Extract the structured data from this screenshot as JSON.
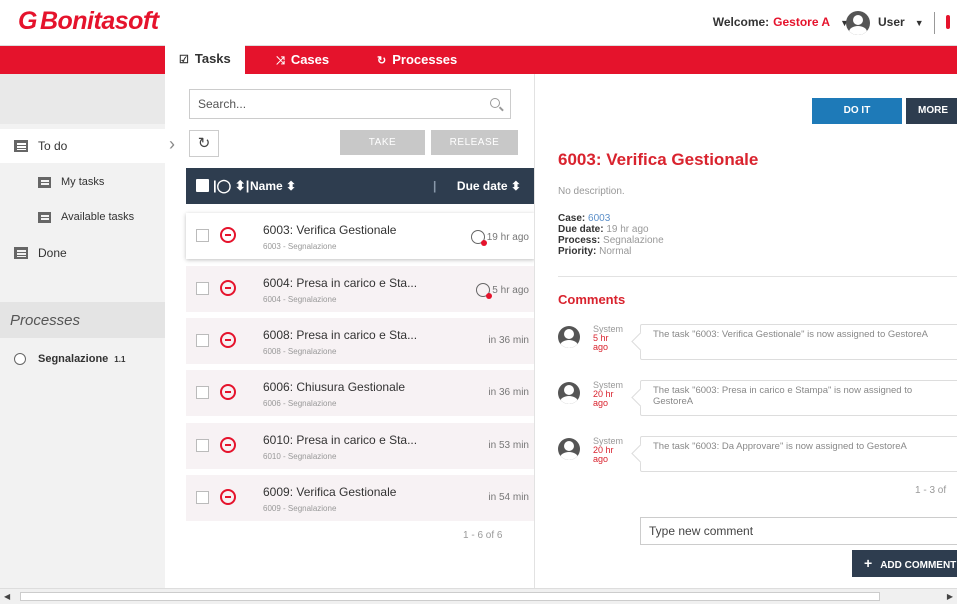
{
  "header": {
    "logo": "Bonitasoft",
    "welcome_label": "Welcome:",
    "welcome_user": "Gestore A",
    "user_label": "User"
  },
  "nav": {
    "tabs": [
      {
        "label": "Tasks",
        "icon": "checkbox-icon"
      },
      {
        "label": "Cases",
        "icon": "shuffle-icon"
      },
      {
        "label": "Processes",
        "icon": "sync-icon"
      }
    ]
  },
  "sidebar": {
    "todo": "To do",
    "my_tasks": "My tasks",
    "available_tasks": "Available tasks",
    "done": "Done",
    "processes_title": "Processes",
    "process_name": "Segnalazione",
    "process_version": "1.1"
  },
  "list": {
    "search_placeholder": "Search...",
    "take_label": "TAKE",
    "release_label": "RELEASE",
    "col_name": "Name ⬍",
    "col_due": "Due date ⬍",
    "tasks": [
      {
        "name": "6003: Verifica Gestionale",
        "sub": "6003 - Segnalazione",
        "due": "19 hr ago"
      },
      {
        "name": "6004: Presa in carico e Sta...",
        "sub": "6004 - Segnalazione",
        "due": "5 hr ago"
      },
      {
        "name": "6008: Presa in carico e Sta...",
        "sub": "6008 - Segnalazione",
        "due": "in 36 min"
      },
      {
        "name": "6006: Chiusura Gestionale",
        "sub": "6006 - Segnalazione",
        "due": "in 36 min"
      },
      {
        "name": "6010: Presa in carico e Sta...",
        "sub": "6010 - Segnalazione",
        "due": "in 53 min"
      },
      {
        "name": "6009: Verifica Gestionale",
        "sub": "6009 - Segnalazione",
        "due": "in 54 min"
      }
    ],
    "pager": "1 - 6 of 6"
  },
  "detail": {
    "do_it_label": "DO IT",
    "more_label": "MORE",
    "title": "6003: Verifica Gestionale",
    "description": "No description.",
    "case_label": "Case:",
    "case_value": "6003",
    "due_label": "Due date:",
    "due_value": "19 hr ago",
    "process_label": "Process:",
    "process_value": "Segnalazione",
    "priority_label": "Priority:",
    "priority_value": "Normal",
    "comments_title": "Comments",
    "comments": [
      {
        "author": "System",
        "time": "5 hr ago",
        "text": "The task \"6003: Verifica Gestionale\" is now assigned to GestoreA"
      },
      {
        "author": "System",
        "time": "20 hr ago",
        "text": "The task \"6003: Presa in carico e Stampa\" is now assigned to GestoreA"
      },
      {
        "author": "System",
        "time": "20 hr ago",
        "text": "The task \"6003: Da Approvare\" is now assigned to GestoreA"
      }
    ],
    "comments_pager": "1 - 3 of",
    "new_comment_placeholder": "Type new comment",
    "add_comment_label": "ADD COMMENT"
  }
}
